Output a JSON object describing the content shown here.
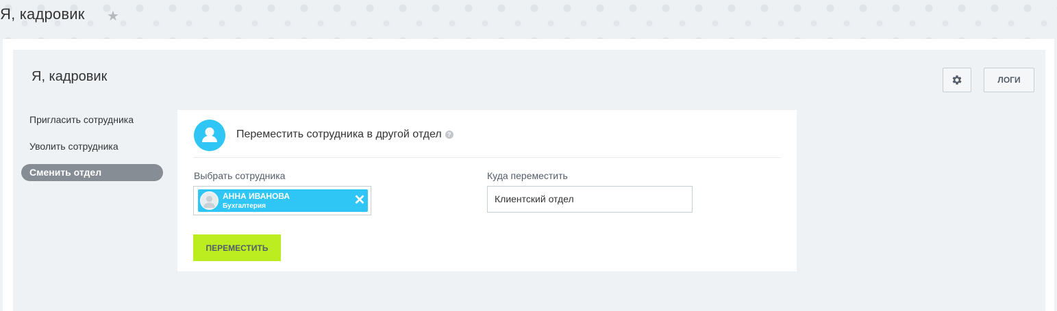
{
  "header": {
    "title": "Я, кадровик",
    "star_icon": "star-icon"
  },
  "panel": {
    "title": "Я, кадровик",
    "settings_icon": "gear-icon",
    "logs_label": "ЛОГИ"
  },
  "sidebar": {
    "items": [
      {
        "label": "Пригласить сотрудника"
      },
      {
        "label": "Уволить сотрудника"
      },
      {
        "label": "Сменить отдел",
        "active": true
      }
    ]
  },
  "form": {
    "title": "Переместить сотрудника в другой отдел",
    "help_glyph": "?",
    "employee_label": "Выбрать сотрудника",
    "employee": {
      "name": "АННА ИВАНОВА",
      "department": "Бухгалтерия"
    },
    "target_label": "Куда переместить",
    "target_value": "Клиентский отдел",
    "submit_label": "ПЕРЕМЕСТИТЬ"
  },
  "colors": {
    "accent_blue": "#2fc6f6",
    "submit_green": "#bbed21",
    "active_item": "#868d95"
  }
}
